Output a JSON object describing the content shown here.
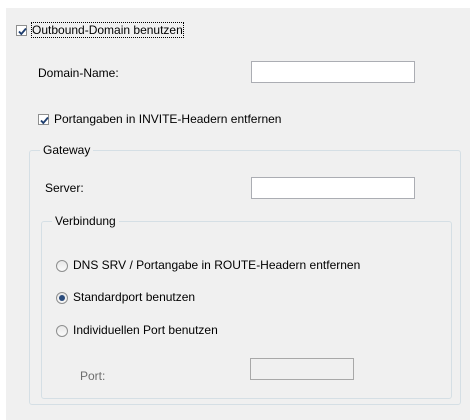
{
  "outbound": {
    "checkbox_label": "Outbound-Domain benutzen",
    "checked": true
  },
  "domain_name": {
    "label": "Domain-Name:",
    "value": ""
  },
  "port_info": {
    "checkbox_label": "Portangaben in INVITE-Headern entfernen",
    "checked": true
  },
  "gateway": {
    "legend": "Gateway",
    "server_label": "Server:",
    "server_value": ""
  },
  "verbindung": {
    "legend": "Verbindung",
    "options": [
      {
        "label": "DNS SRV / Portangabe in ROUTE-Headern entfernen",
        "selected": false
      },
      {
        "label": "Standardport benutzen",
        "selected": true
      },
      {
        "label": "Individuellen Port benutzen",
        "selected": false
      }
    ],
    "port_label": "Port:",
    "port_value": ""
  }
}
